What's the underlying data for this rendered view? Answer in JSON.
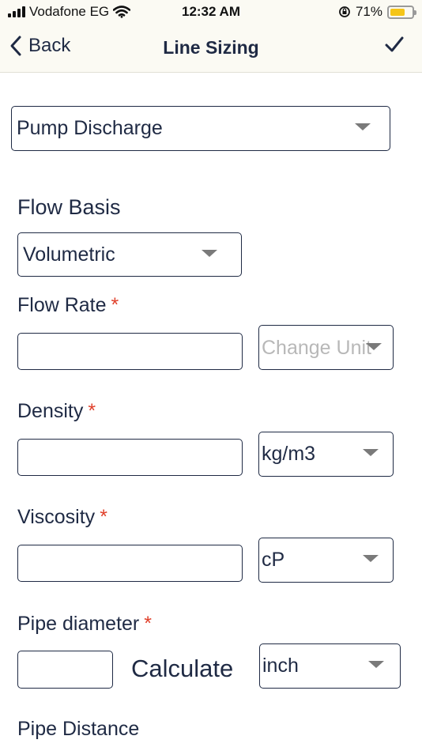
{
  "status_bar": {
    "carrier": "Vodafone EG",
    "time": "12:32 AM",
    "battery_percent": "71%",
    "battery_level": 0.71
  },
  "nav": {
    "back_label": "Back",
    "title": "Line Sizing",
    "confirm_icon": "checkmark-icon"
  },
  "form": {
    "service_select": {
      "value": "Pump Discharge"
    },
    "flow_basis": {
      "title": "Flow Basis",
      "select_value": "Volumetric"
    },
    "flow_rate": {
      "label": "Flow Rate",
      "required_mark": "*",
      "value": "",
      "unit_placeholder": "Change Unit"
    },
    "density": {
      "label": "Density",
      "required_mark": "*",
      "value": "",
      "unit": "kg/m3"
    },
    "viscosity": {
      "label": "Viscosity",
      "required_mark": "*",
      "value": "",
      "unit": "cP"
    },
    "pipe_diameter": {
      "label": "Pipe diameter",
      "required_mark": "*",
      "value": "",
      "calculate_label": "Calculate",
      "unit": "inch"
    },
    "pipe_distance": {
      "label": "Pipe Distance"
    }
  },
  "colors": {
    "text": "#1f2a44",
    "required": "#e0402b",
    "bar_background": "#fbfaf3",
    "battery": "#f5c518"
  }
}
